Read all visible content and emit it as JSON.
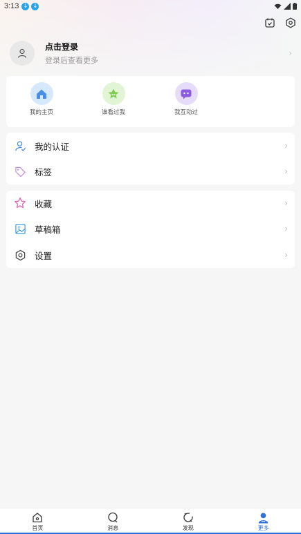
{
  "status_bar": {
    "time": "3:13"
  },
  "profile": {
    "title": "点击登录",
    "subtitle": "登录后查看更多"
  },
  "quick_actions": [
    {
      "label": "我的主页",
      "icon": "home-icon",
      "color": "#4a8ee8"
    },
    {
      "label": "谁看过我",
      "icon": "star-face-icon",
      "color": "#7ccd4d"
    },
    {
      "label": "我互动过",
      "icon": "chat-bubble-icon",
      "color": "#8b5be0"
    }
  ],
  "menu_group_1": [
    {
      "label": "我的认证",
      "icon": "user-verify-icon"
    },
    {
      "label": "标签",
      "icon": "tag-icon"
    }
  ],
  "menu_group_2": [
    {
      "label": "收藏",
      "icon": "star-icon"
    },
    {
      "label": "草稿箱",
      "icon": "drafts-icon"
    },
    {
      "label": "设置",
      "icon": "gear-icon"
    }
  ],
  "bottom_nav": [
    {
      "label": "首页",
      "icon": "home-icon"
    },
    {
      "label": "消息",
      "icon": "message-icon"
    },
    {
      "label": "发现",
      "icon": "discover-icon"
    },
    {
      "label": "更多",
      "icon": "profile-icon",
      "active": true
    }
  ],
  "colors": {
    "accent": "#2f6fd6",
    "background": "#f6f6f6"
  }
}
